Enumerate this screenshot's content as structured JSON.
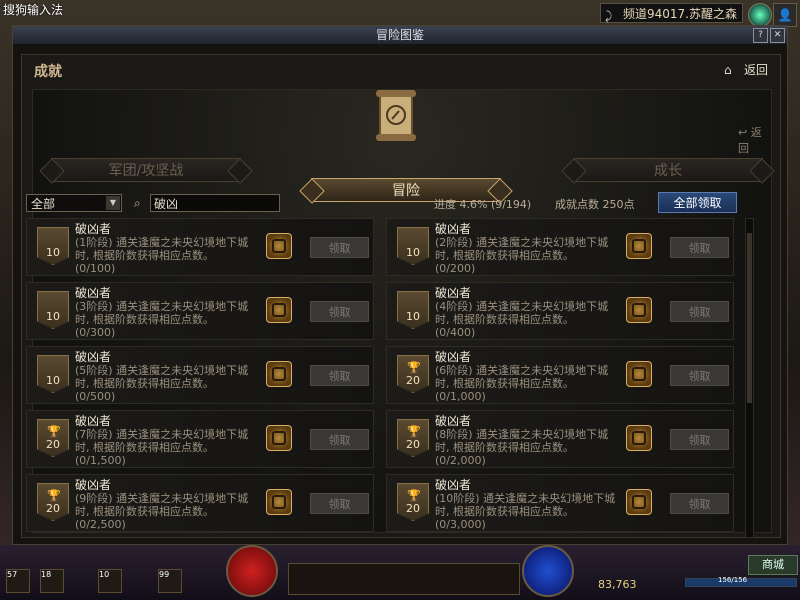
{
  "ime_label": "搜狗输入法",
  "channel": "频道94017.苏醒之森",
  "window": {
    "title": "冒险图鉴",
    "panel_title": "成就",
    "back_top": "返回",
    "back_inner": "返回"
  },
  "tabs": {
    "left": "军团/攻坚战",
    "active": "冒险",
    "right": "成长"
  },
  "filter": {
    "selected": "全部",
    "search_value": "破凶"
  },
  "progress": "进度  4.6% (9/194)",
  "points": "成就点数 250点",
  "claim_all": "全部领取",
  "claim_label": "领取",
  "cards": [
    {
      "name": "破凶者",
      "desc": "(1阶段) 通关逢魔之未央幻境地下城时, 根据阶数获得相应点数。",
      "progress": "(0/100)",
      "badge": "10",
      "cup": false
    },
    {
      "name": "破凶者",
      "desc": "(2阶段) 通关逢魔之未央幻境地下城时, 根据阶数获得相应点数。",
      "progress": "(0/200)",
      "badge": "10",
      "cup": false
    },
    {
      "name": "破凶者",
      "desc": "(3阶段) 通关逢魔之未央幻境地下城时, 根据阶数获得相应点数。",
      "progress": "(0/300)",
      "badge": "10",
      "cup": false
    },
    {
      "name": "破凶者",
      "desc": "(4阶段) 通关逢魔之未央幻境地下城时, 根据阶数获得相应点数。",
      "progress": "(0/400)",
      "badge": "10",
      "cup": false
    },
    {
      "name": "破凶者",
      "desc": "(5阶段) 通关逢魔之未央幻境地下城时, 根据阶数获得相应点数。",
      "progress": "(0/500)",
      "badge": "10",
      "cup": false
    },
    {
      "name": "破凶者",
      "desc": "(6阶段) 通关逢魔之未央幻境地下城时, 根据阶数获得相应点数。",
      "progress": "(0/1,000)",
      "badge": "20",
      "cup": true
    },
    {
      "name": "破凶者",
      "desc": "(7阶段) 通关逢魔之未央幻境地下城时, 根据阶数获得相应点数。",
      "progress": "(0/1,500)",
      "badge": "20",
      "cup": true
    },
    {
      "name": "破凶者",
      "desc": "(8阶段) 通关逢魔之未央幻境地下城时, 根据阶数获得相应点数。",
      "progress": "(0/2,000)",
      "badge": "20",
      "cup": true
    },
    {
      "name": "破凶者",
      "desc": "(9阶段) 通关逢魔之未央幻境地下城时, 根据阶数获得相应点数。",
      "progress": "(0/2,500)",
      "badge": "20",
      "cup": true
    },
    {
      "name": "破凶者",
      "desc": "(10阶段) 通关逢魔之未央幻境地下城时, 根据阶数获得相应点数。",
      "progress": "(0/3,000)",
      "badge": "20",
      "cup": true
    }
  ],
  "hud": {
    "gold": "83,763",
    "shop": "商城",
    "exp_text": "156/156",
    "skill_counts": [
      "57",
      "18",
      "10",
      "99"
    ]
  },
  "colors": {
    "accent_gold": "#c9a66b",
    "claim_all_blue": "#2a4a7a",
    "disabled_button": "#3a3835"
  }
}
